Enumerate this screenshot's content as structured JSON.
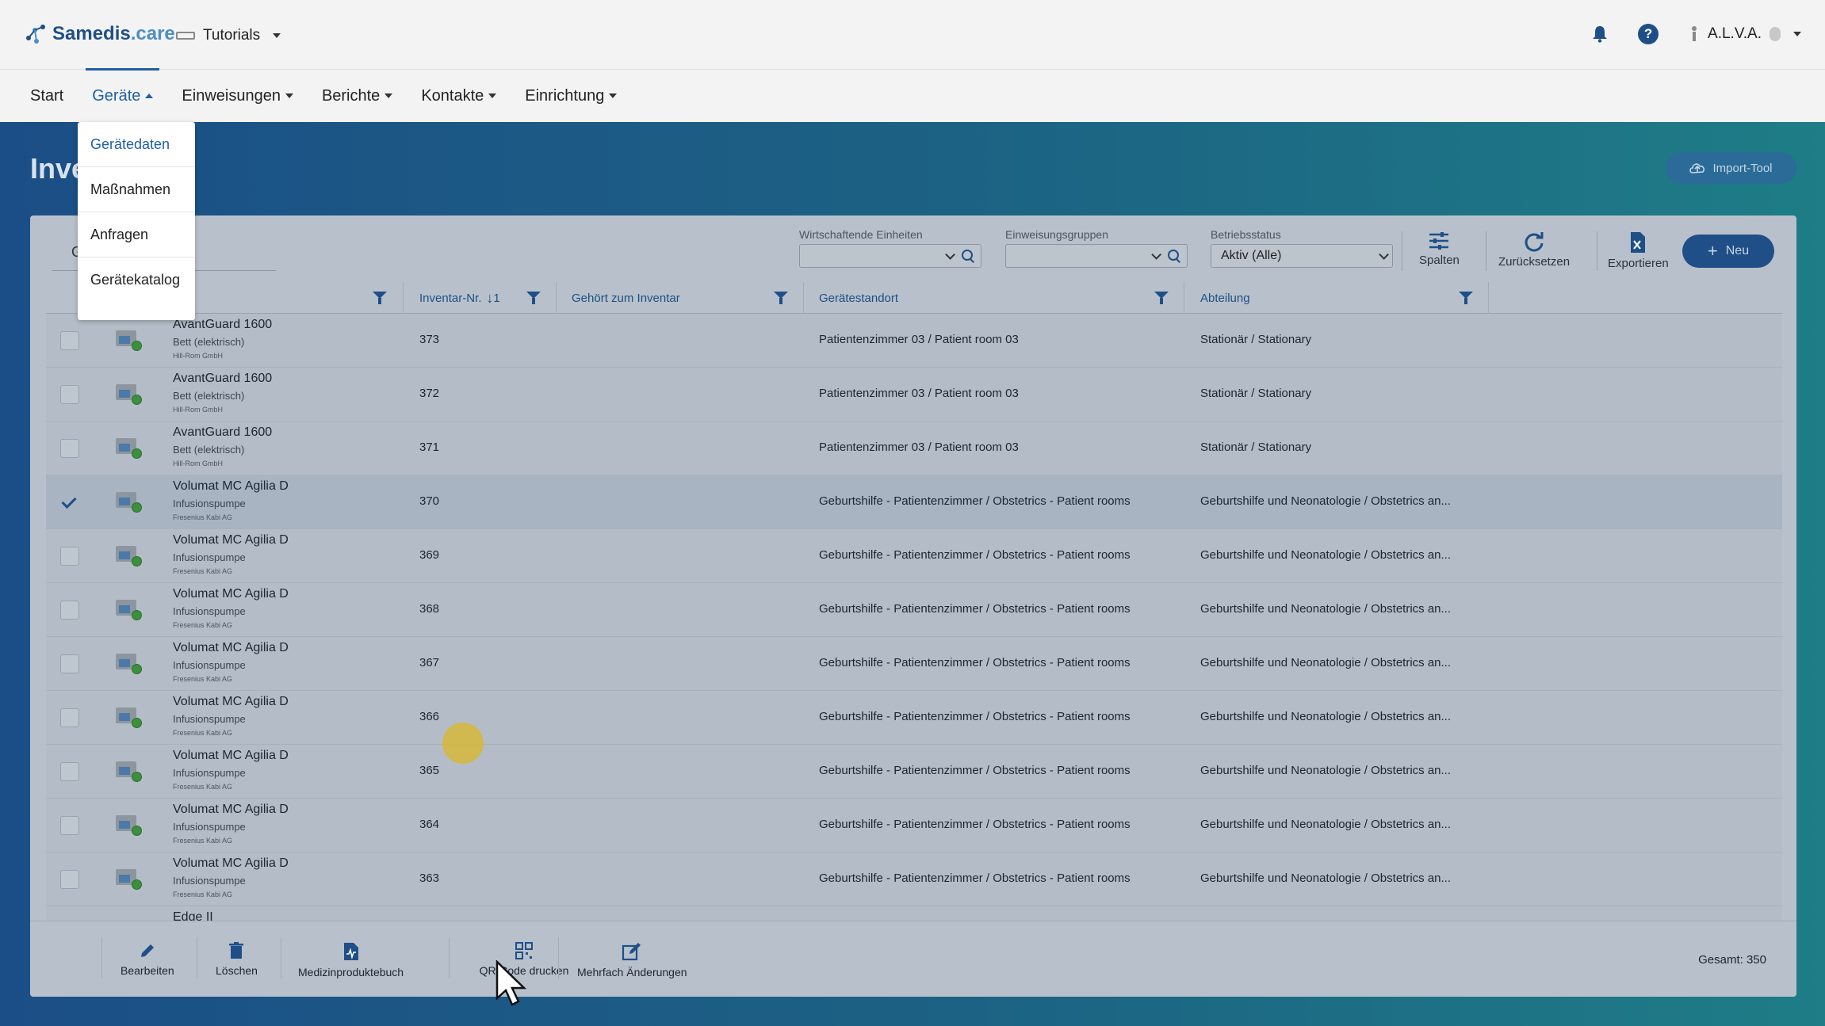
{
  "header": {
    "logo_main": "Samedis",
    "logo_suffix": ".care",
    "workspace": "Tutorials",
    "user": "A.L.V.A."
  },
  "nav": {
    "items": [
      {
        "label": "Start"
      },
      {
        "label": "Geräte"
      },
      {
        "label": "Einweisungen"
      },
      {
        "label": "Berichte"
      },
      {
        "label": "Kontakte"
      },
      {
        "label": "Einrichtung"
      }
    ]
  },
  "dropdown": {
    "items": [
      {
        "label": "Gerätedaten"
      },
      {
        "label": "Maßnahmen"
      },
      {
        "label": "Anfragen"
      },
      {
        "label": "Gerätekatalog"
      }
    ]
  },
  "page": {
    "title_stub": "Inve",
    "import_label": "Import-Tool"
  },
  "filters": {
    "search_stub": "G",
    "units_label": "Wirtschaftende Einheiten",
    "groups_label": "Einweisungsgruppen",
    "status_label": "Betriebsstatus",
    "status_value": "Aktiv (Alle)"
  },
  "toolbar": {
    "columns": "Spalten",
    "reset": "Zurücksetzen",
    "export": "Exportieren",
    "new": "Neu"
  },
  "table": {
    "headers": {
      "device_stub": "t",
      "inventory": "Inventar-Nr.",
      "sort_index": "1",
      "belongs": "Gehört zum Inventar",
      "location": "Gerätestandort",
      "department": "Abteilung"
    },
    "rows": [
      {
        "name": "AvantGuard 1600",
        "type": "Bett (elektrisch)",
        "mfr": "Hill-Rom GmbH",
        "inv": "373",
        "location": "Patientenzimmer 03 / Patient room 03",
        "department": "Stationär / Stationary",
        "checked": false
      },
      {
        "name": "AvantGuard 1600",
        "type": "Bett (elektrisch)",
        "mfr": "Hill-Rom GmbH",
        "inv": "372",
        "location": "Patientenzimmer 03 / Patient room 03",
        "department": "Stationär / Stationary",
        "checked": false
      },
      {
        "name": "AvantGuard 1600",
        "type": "Bett (elektrisch)",
        "mfr": "Hill-Rom GmbH",
        "inv": "371",
        "location": "Patientenzimmer 03 / Patient room 03",
        "department": "Stationär / Stationary",
        "checked": false
      },
      {
        "name": "Volumat MC Agilia D",
        "type": "Infusionspumpe",
        "mfr": "Fresenius Kabi AG",
        "inv": "370",
        "location": "Geburtshilfe - Patientenzimmer / Obstetrics - Patient rooms",
        "department": "Geburtshilfe und Neonatologie / Obstetrics an...",
        "checked": true
      },
      {
        "name": "Volumat MC Agilia D",
        "type": "Infusionspumpe",
        "mfr": "Fresenius Kabi AG",
        "inv": "369",
        "location": "Geburtshilfe - Patientenzimmer / Obstetrics - Patient rooms",
        "department": "Geburtshilfe und Neonatologie / Obstetrics an...",
        "checked": false
      },
      {
        "name": "Volumat MC Agilia D",
        "type": "Infusionspumpe",
        "mfr": "Fresenius Kabi AG",
        "inv": "368",
        "location": "Geburtshilfe - Patientenzimmer / Obstetrics - Patient rooms",
        "department": "Geburtshilfe und Neonatologie / Obstetrics an...",
        "checked": false
      },
      {
        "name": "Volumat MC Agilia D",
        "type": "Infusionspumpe",
        "mfr": "Fresenius Kabi AG",
        "inv": "367",
        "location": "Geburtshilfe - Patientenzimmer / Obstetrics - Patient rooms",
        "department": "Geburtshilfe und Neonatologie / Obstetrics an...",
        "checked": false
      },
      {
        "name": "Volumat MC Agilia D",
        "type": "Infusionspumpe",
        "mfr": "Fresenius Kabi AG",
        "inv": "366",
        "location": "Geburtshilfe - Patientenzimmer / Obstetrics - Patient rooms",
        "department": "Geburtshilfe und Neonatologie / Obstetrics an...",
        "checked": false
      },
      {
        "name": "Volumat MC Agilia D",
        "type": "Infusionspumpe",
        "mfr": "Fresenius Kabi AG",
        "inv": "365",
        "location": "Geburtshilfe - Patientenzimmer / Obstetrics - Patient rooms",
        "department": "Geburtshilfe und Neonatologie / Obstetrics an...",
        "checked": false
      },
      {
        "name": "Volumat MC Agilia D",
        "type": "Infusionspumpe",
        "mfr": "Fresenius Kabi AG",
        "inv": "364",
        "location": "Geburtshilfe - Patientenzimmer / Obstetrics - Patient rooms",
        "department": "Geburtshilfe und Neonatologie / Obstetrics an...",
        "checked": false
      },
      {
        "name": "Volumat MC Agilia D",
        "type": "Infusionspumpe",
        "mfr": "Fresenius Kabi AG",
        "inv": "363",
        "location": "Geburtshilfe - Patientenzimmer / Obstetrics - Patient rooms",
        "department": "Geburtshilfe und Neonatologie / Obstetrics an...",
        "checked": false
      },
      {
        "name": "Edge II",
        "type": "",
        "mfr": "",
        "inv": "",
        "location": "",
        "department": "",
        "checked": false
      }
    ]
  },
  "actions": {
    "edit": "Bearbeiten",
    "delete": "Löschen",
    "logbook": "Medizinproduktebuch",
    "qr": "QR-Code drucken",
    "bulk": "Mehrfach Änderungen",
    "total": "Gesamt: 350"
  },
  "colors": {
    "primary": "#1f4f86",
    "accent": "#1f5fa5",
    "status_ok": "#3c8f3c",
    "highlight": "#d6b739"
  }
}
